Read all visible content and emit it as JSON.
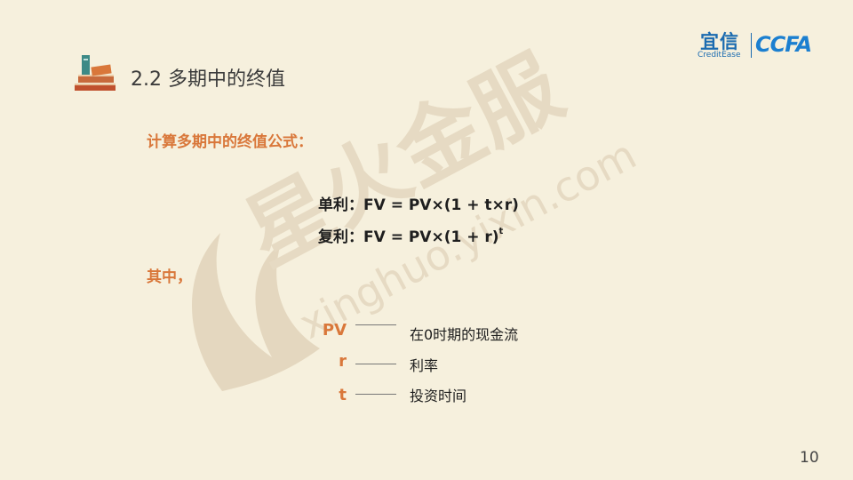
{
  "header": {
    "title": "2.2 多期中的终值",
    "logo_yixin_cn": "宜信",
    "logo_yixin_en": "CreditEase",
    "logo_ccf": "CCFA"
  },
  "watermark": {
    "text_cn": "星火金服",
    "text_en": "xinghuo.yixin.com"
  },
  "content": {
    "subtitle": "计算多期中的终值公式：",
    "formula_simple_label": "单利：",
    "formula_simple": "FV = PV×(1 + t×r)",
    "formula_compound_label": "复利：",
    "formula_compound": "FV = PV×(1 + r)",
    "formula_compound_exp": "t",
    "where_label": "其中，",
    "definitions": [
      {
        "symbol": "PV",
        "description": "在0时期的现金流"
      },
      {
        "symbol": "r",
        "description": "利率"
      },
      {
        "symbol": "t",
        "description": "投资时间"
      }
    ]
  },
  "footer": {
    "page_number": "10"
  },
  "colors": {
    "background": "#f6f0dd",
    "accent_orange": "#d9773a",
    "brand_blue": "#1b6bb0"
  }
}
